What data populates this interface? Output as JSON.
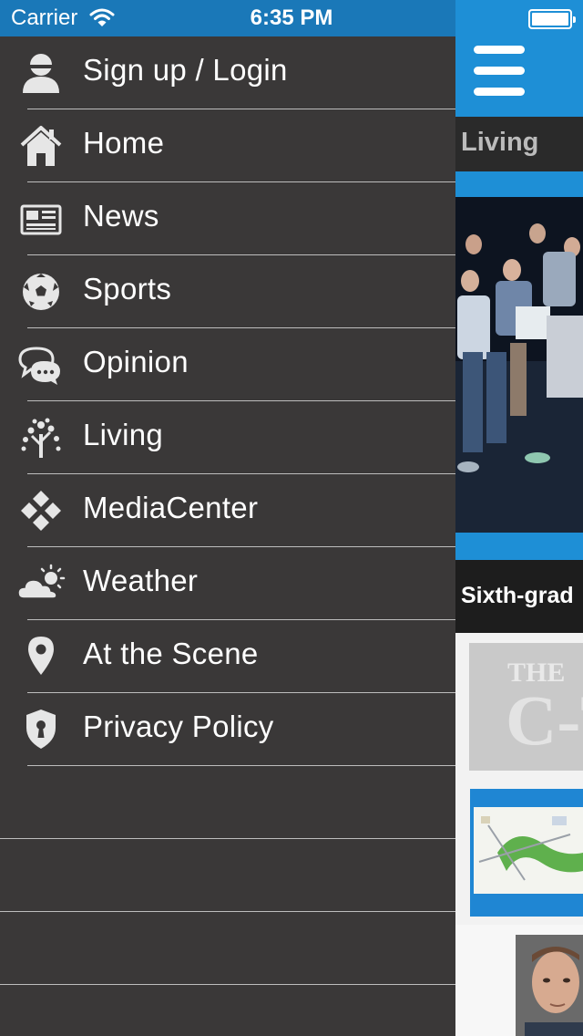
{
  "status_bar": {
    "carrier": "Carrier",
    "time": "6:35 PM"
  },
  "menu": {
    "items": [
      {
        "label": "Sign up / Login",
        "icon": "user-icon"
      },
      {
        "label": "Home",
        "icon": "home-icon"
      },
      {
        "label": "News",
        "icon": "newspaper-icon"
      },
      {
        "label": "Sports",
        "icon": "soccer-ball-icon"
      },
      {
        "label": "Opinion",
        "icon": "chat-bubbles-icon"
      },
      {
        "label": "Living",
        "icon": "tree-icon"
      },
      {
        "label": "MediaCenter",
        "icon": "diamond-grid-icon"
      },
      {
        "label": "Weather",
        "icon": "cloud-sun-icon"
      },
      {
        "label": "At the Scene",
        "icon": "location-pin-icon"
      },
      {
        "label": "Privacy Policy",
        "icon": "shield-lock-icon"
      }
    ]
  },
  "content": {
    "section_title": "Living",
    "headline": "Sixth-grad",
    "logo_text_top": "THE",
    "logo_text_main": "C-T"
  },
  "colors": {
    "sidebar_bg": "#3a3838",
    "accent_blue": "#1e8fd6",
    "status_bar_blue": "#1a78b8"
  }
}
